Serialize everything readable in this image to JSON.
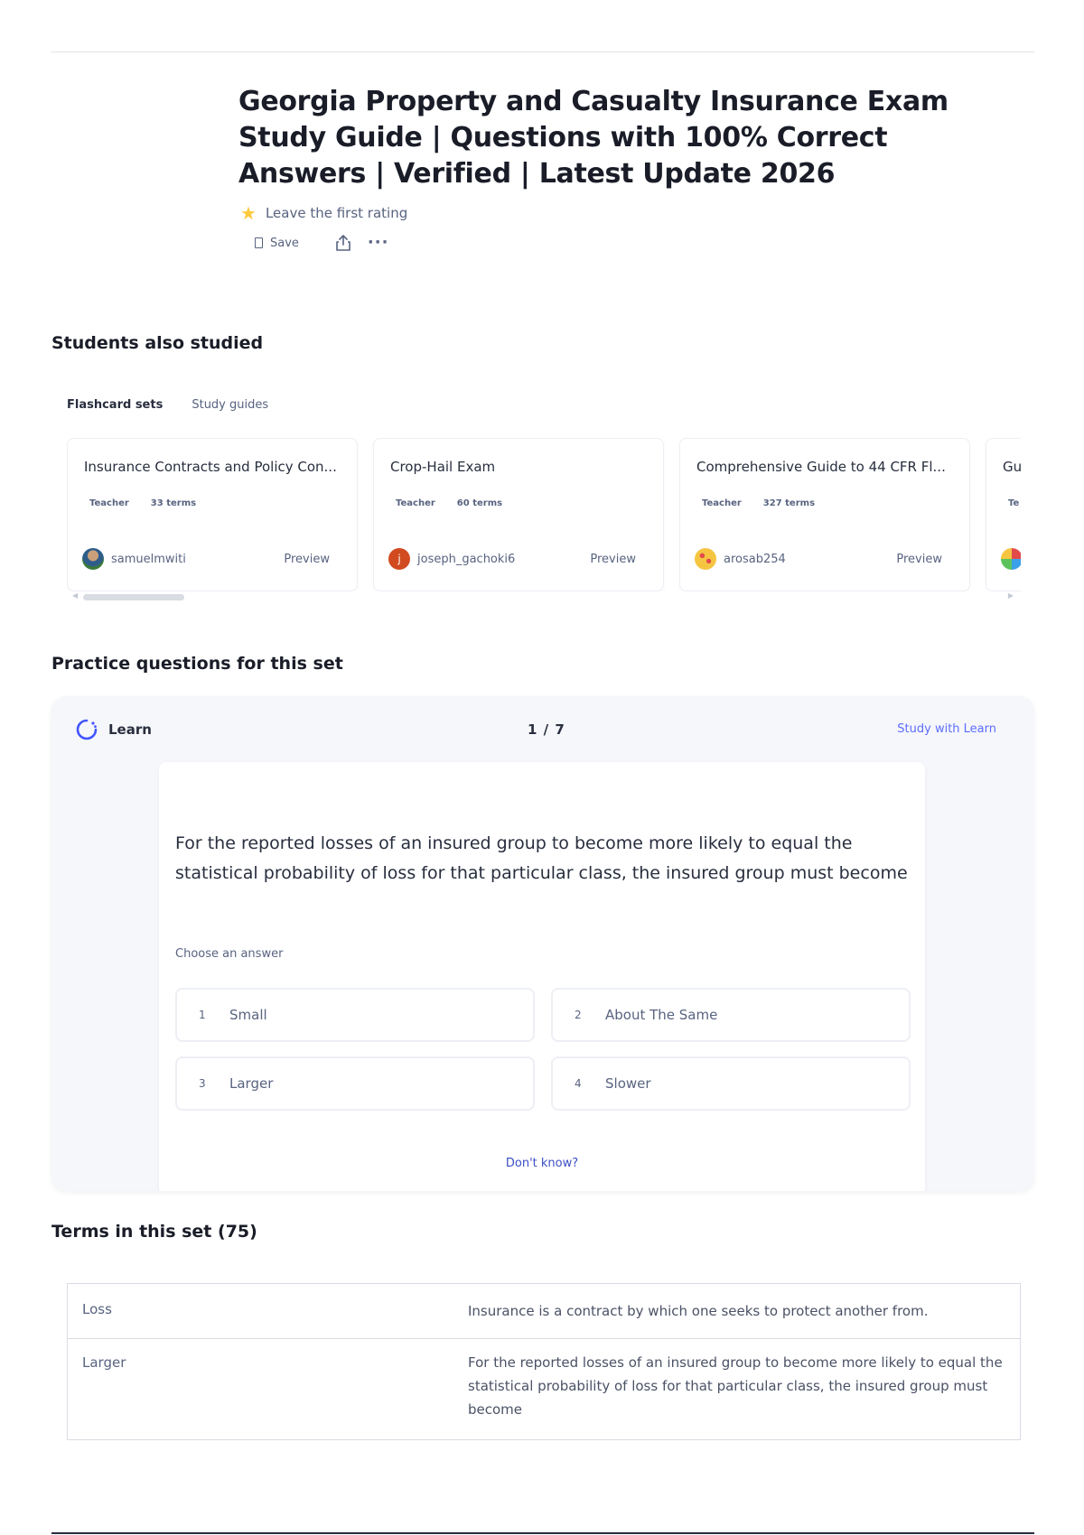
{
  "header": {
    "title": "Georgia Property and Casualty Insurance Exam Study Guide | Questions with 100% Correct Answers | Verified | Latest Update 2026",
    "rating_text": "Leave the first rating",
    "save_label": "Save",
    "more_label": "···"
  },
  "students_also_studied": {
    "heading": "Students also studied",
    "tabs": [
      {
        "label": "Flashcard sets",
        "active": true
      },
      {
        "label": "Study guides",
        "active": false
      }
    ],
    "cards": [
      {
        "title": "Insurance Contracts and Policy Con...",
        "type": "Teacher",
        "terms": "33 terms",
        "author": "samuelmwiti",
        "preview": "Preview"
      },
      {
        "title": "Crop-Hail Exam",
        "type": "Teacher",
        "terms": "60 terms",
        "author": "joseph_gachoki6",
        "preview": "Preview"
      },
      {
        "title": "Comprehensive Guide to 44 CFR Fl...",
        "type": "Teacher",
        "terms": "327 terms",
        "author": "arosab254",
        "preview": "Preview"
      },
      {
        "title": "Gu",
        "type": "Te",
        "terms": "",
        "author": "",
        "preview": ""
      }
    ]
  },
  "practice": {
    "heading": "Practice questions for this set",
    "mode_label": "Learn",
    "progress": "1 / 7",
    "study_link": "Study with Learn",
    "question": "For the reported losses of an insured group to become more likely to equal the statistical probability of loss for that particular class, the insured group must become",
    "choose_label": "Choose an answer",
    "answers": [
      {
        "num": "1",
        "text": "Small"
      },
      {
        "num": "2",
        "text": "About The Same"
      },
      {
        "num": "3",
        "text": "Larger"
      },
      {
        "num": "4",
        "text": "Slower"
      }
    ],
    "dont_know": "Don't know?"
  },
  "terms": {
    "heading": "Terms in this set (75)",
    "rows": [
      {
        "term": "Loss",
        "definition": "Insurance is a contract by which one seeks to protect another from."
      },
      {
        "term": "Larger",
        "definition": "For the reported losses of an insured group to become more likely to equal the statistical probability of loss for that particular class, the insured group must become"
      }
    ]
  },
  "colors": {
    "accent": "#4255ff",
    "text_primary": "#282e3e",
    "text_secondary": "#586380",
    "panel_bg": "#f6f7fb",
    "star": "#ffc93c"
  },
  "icons": [
    "star-icon",
    "bookmark-icon",
    "share-icon",
    "more-icon",
    "learn-icon",
    "avatar"
  ]
}
